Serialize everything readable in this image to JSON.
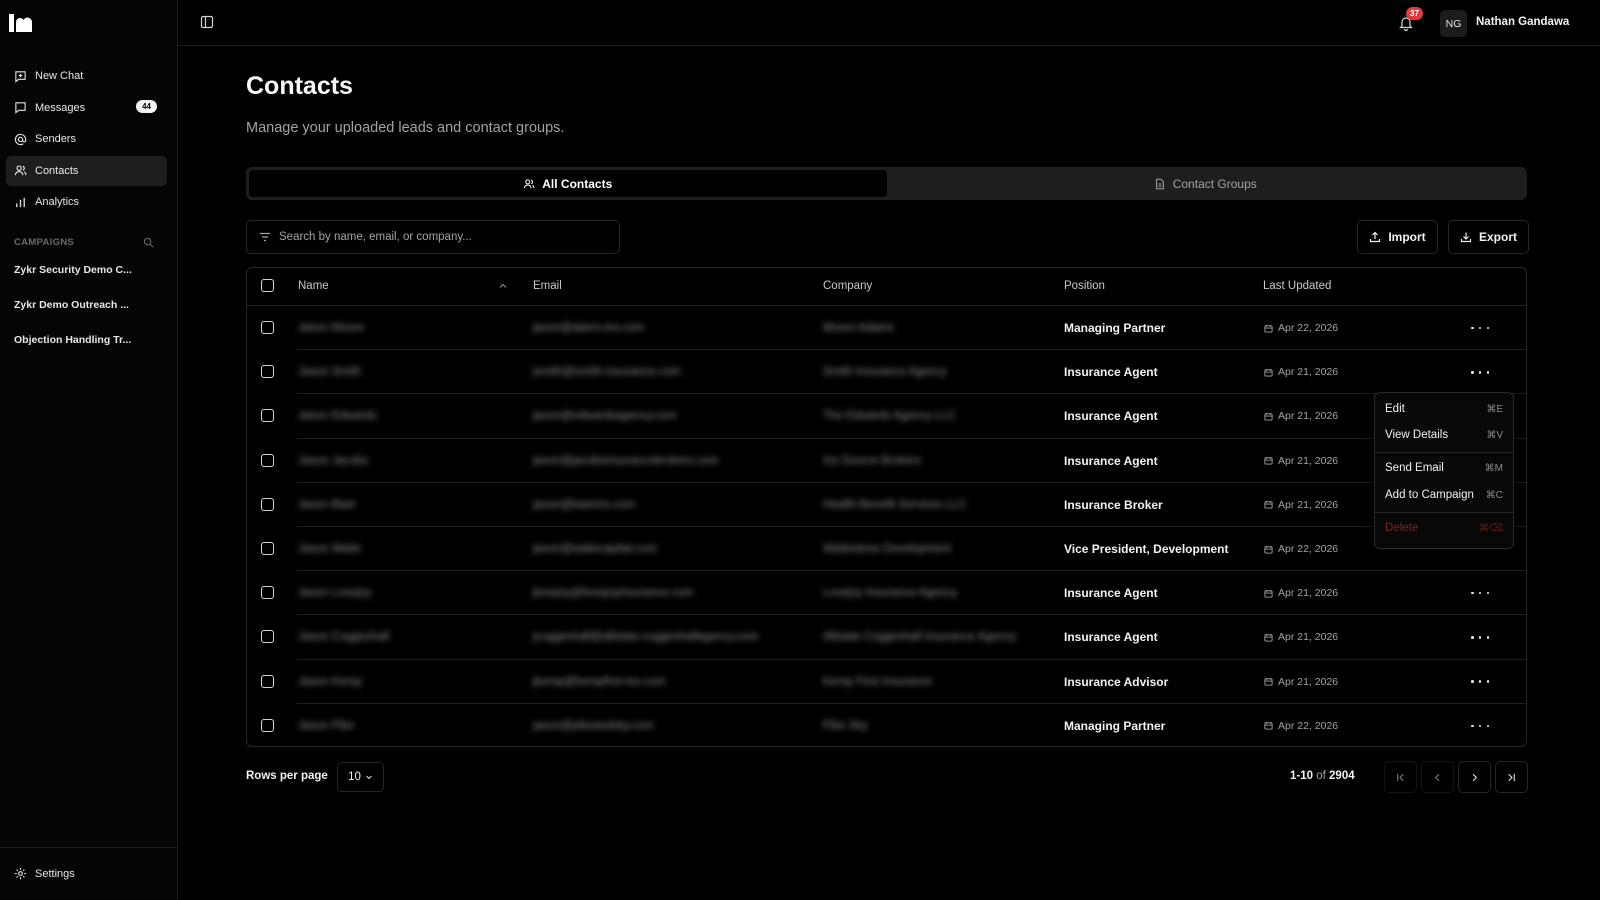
{
  "app": {
    "user_initials": "NG",
    "user_name": "Nathan Gandawa",
    "notifications": "37"
  },
  "sidebar": {
    "items": [
      {
        "label": "New Chat",
        "icon": "chat-plus-icon"
      },
      {
        "label": "Messages",
        "icon": "message-icon",
        "badge": "44"
      },
      {
        "label": "Senders",
        "icon": "at-sign-icon"
      },
      {
        "label": "Contacts",
        "icon": "users-icon",
        "active": true
      },
      {
        "label": "Analytics",
        "icon": "bar-chart-icon"
      }
    ],
    "campaigns_heading": "CAMPAIGNS",
    "campaigns": [
      "Zykr Security Demo C...",
      "Zykr Demo Outreach ...",
      "Objection Handling Tr..."
    ],
    "settings_label": "Settings"
  },
  "main": {
    "title": "Contacts",
    "subtitle": "Manage your uploaded leads and contact groups.",
    "tabs": [
      {
        "label": "All Contacts",
        "active": true
      },
      {
        "label": "Contact Groups"
      }
    ],
    "search_placeholder": "Search by name, email, or company...",
    "import_label": "Import",
    "export_label": "Export"
  },
  "table": {
    "headers": {
      "name": "Name",
      "email": "Email",
      "company": "Company",
      "position": "Position",
      "updated": "Last Updated"
    },
    "rows": [
      {
        "name": "Jason Moore",
        "email": "jason@alarm-ins.com",
        "company": "Moore Adams",
        "position": "Managing Partner",
        "updated": "Apr 22, 2026"
      },
      {
        "name": "Jason Smith",
        "email": "jsmith@smith-insurance.com",
        "company": "Smith Insurance Agency",
        "position": "Insurance Agent",
        "updated": "Apr 21, 2026"
      },
      {
        "name": "Jason Edwards",
        "email": "jason@edwardsagency.com",
        "company": "The Edwards Agency LLC",
        "position": "Insurance Agent",
        "updated": "Apr 21, 2026"
      },
      {
        "name": "Jason Jacobs",
        "email": "jason@jacobsinsurancebrokers.com",
        "company": "Ins Source Brokers",
        "position": "Insurance Agent",
        "updated": "Apr 21, 2026"
      },
      {
        "name": "Jason Baer",
        "email": "jason@baerins.com",
        "company": "Health Benefit Services LLC",
        "position": "Insurance Broker",
        "updated": "Apr 21, 2026"
      },
      {
        "name": "Jason Waite",
        "email": "jason@waitecapital.com",
        "company": "Waitestone Development",
        "position": "Vice President, Development",
        "updated": "Apr 22, 2026"
      },
      {
        "name": "Jason Lovejoy",
        "email": "jlovejoy@lovejoyinsurance.com",
        "company": "Lovejoy Insurance Agency",
        "position": "Insurance Agent",
        "updated": "Apr 21, 2026"
      },
      {
        "name": "Jason Coggeshall",
        "email": "jcoggeshall@allstate-coggeshallagency.com",
        "company": "Allstate Coggeshall Insurance Agency",
        "position": "Insurance Agent",
        "updated": "Apr 21, 2026"
      },
      {
        "name": "Jason Kemp",
        "email": "jkemp@kempfirst-ins.com",
        "company": "Kemp First Insurance",
        "position": "Insurance Advisor",
        "updated": "Apr 21, 2026"
      },
      {
        "name": "Jason Pike",
        "email": "jason@pikeandsky.com",
        "company": "Pike Sky",
        "position": "Managing Partner",
        "updated": "Apr 22, 2026"
      }
    ]
  },
  "context_menu": {
    "items": [
      {
        "label": "Edit",
        "shortcut": "⌘E"
      },
      {
        "label": "View Details",
        "shortcut": "⌘V"
      },
      {
        "label": "Send Email",
        "shortcut": "⌘M"
      },
      {
        "label": "Add to Campaign",
        "shortcut": "⌘C"
      },
      {
        "label": "Delete",
        "shortcut": "⌘⌫"
      }
    ]
  },
  "pagination": {
    "rows_label": "Rows per page",
    "rows_value": "10",
    "range": "1-10",
    "of": "of",
    "total": "2904"
  }
}
